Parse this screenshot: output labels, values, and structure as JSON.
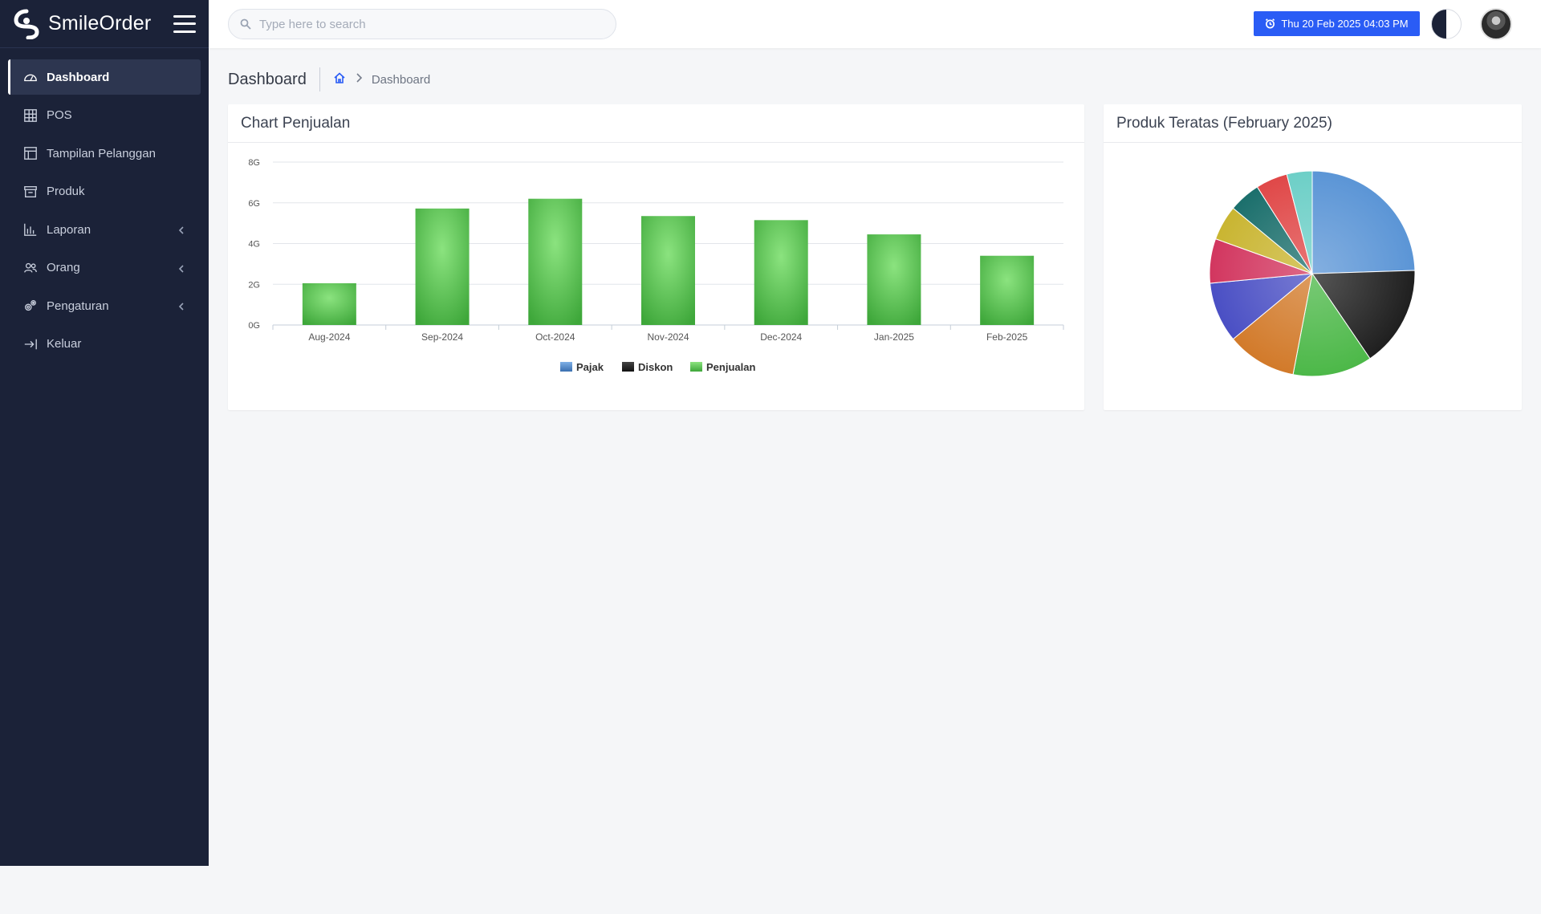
{
  "app": {
    "name": "SmileOrder"
  },
  "sidebar": {
    "items": [
      {
        "label": "Dashboard",
        "icon": "gauge-icon",
        "active": true
      },
      {
        "label": "POS",
        "icon": "grid-icon"
      },
      {
        "label": "Tampilan Pelanggan",
        "icon": "layout-icon"
      },
      {
        "label": "Produk",
        "icon": "archive-icon"
      },
      {
        "label": "Laporan",
        "icon": "bar-chart-icon",
        "expandable": true
      },
      {
        "label": "Orang",
        "icon": "users-icon",
        "expandable": true
      },
      {
        "label": "Pengaturan",
        "icon": "gears-icon",
        "expandable": true
      },
      {
        "label": "Keluar",
        "icon": "logout-icon"
      }
    ]
  },
  "topbar": {
    "search_placeholder": "Type here to search",
    "datetime": "Thu 20 Feb 2025 04:03 PM",
    "accent": "#2a5cf5"
  },
  "breadcrumb": {
    "title": "Dashboard",
    "current": "Dashboard"
  },
  "cards": {
    "sales_title": "Chart Penjualan",
    "top_products_title": "Produk Teratas (February 2025)"
  },
  "chart_data": [
    {
      "type": "bar",
      "title": "Chart Penjualan",
      "categories": [
        "Aug-2024",
        "Sep-2024",
        "Oct-2024",
        "Nov-2024",
        "Dec-2024",
        "Jan-2025",
        "Feb-2025"
      ],
      "y_ticks": [
        "0G",
        "2G",
        "4G",
        "6G",
        "8G"
      ],
      "ylim": [
        0,
        8
      ],
      "grid": true,
      "legend_position": "bottom",
      "series": [
        {
          "name": "Pajak",
          "color": "#4a7fc4",
          "values": [
            0,
            0,
            0,
            0,
            0,
            0,
            0
          ]
        },
        {
          "name": "Diskon",
          "color": "#1a1a1a",
          "values": [
            0,
            0,
            0,
            0,
            0,
            0,
            0
          ]
        },
        {
          "name": "Penjualan",
          "color": "#4cb848",
          "values": [
            2.05,
            5.72,
            6.2,
            5.35,
            5.15,
            4.45,
            3.4
          ]
        }
      ]
    },
    {
      "type": "pie",
      "title": "Produk Teratas (February 2025)",
      "slices": [
        {
          "value": 24.5,
          "color": "#5b95d6"
        },
        {
          "value": 16.0,
          "color": "#1f1f1f"
        },
        {
          "value": 12.5,
          "color": "#4cb848"
        },
        {
          "value": 11.0,
          "color": "#d27a2a"
        },
        {
          "value": 9.5,
          "color": "#4a4fc4"
        },
        {
          "value": 7.0,
          "color": "#d2365f"
        },
        {
          "value": 5.5,
          "color": "#c9b531"
        },
        {
          "value": 5.0,
          "color": "#1b6f6c"
        },
        {
          "value": 5.0,
          "color": "#e04848"
        },
        {
          "value": 4.0,
          "color": "#6dcfc7"
        }
      ]
    }
  ]
}
